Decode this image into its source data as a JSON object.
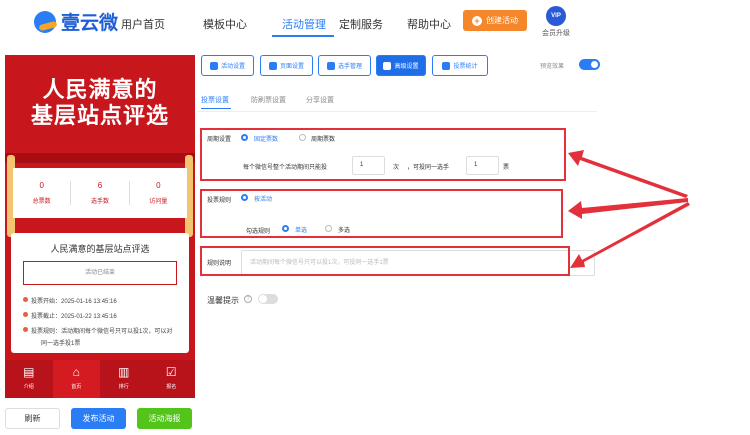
{
  "app": {
    "logo_text": "壹云微"
  },
  "nav": {
    "items": [
      "用户首页",
      "模板中心",
      "活动管理",
      "定制服务",
      "帮助中心"
    ],
    "create_button": "创建活动",
    "vip_badge": "VIP",
    "vip_label": "会员升级"
  },
  "preview": {
    "hero_line1": "人民满意的",
    "hero_line2": "基层站点评选",
    "stats": [
      {
        "value": "0",
        "label": "总票数"
      },
      {
        "value": "6",
        "label": "选手数"
      },
      {
        "value": "0",
        "label": "访问量"
      }
    ],
    "info_title": "人民满意的基层站点评选",
    "status": "活动已结束",
    "rows": [
      "投票开始：2025-01-16 13:45:16",
      "投票截止：2025-01-22 13:45:16",
      "投票规则：活动期间每个微信号只可以投1次，可以对",
      "同一选手投1票"
    ],
    "tabs": [
      "介绍",
      "首页",
      "排行",
      "报名"
    ]
  },
  "bottom_buttons": {
    "refresh": "刷新",
    "publish": "发布活动",
    "poster": "活动海报"
  },
  "toolbar": {
    "buttons": [
      "活动设置",
      "页面设置",
      "选手管理",
      "高级设置",
      "投票统计"
    ],
    "preview_label": "预览效果"
  },
  "subtabs": [
    "投票设置",
    "防刷票设置",
    "分享设置"
  ],
  "settings": {
    "cycle_label": "周期设置",
    "cycle_options": [
      "固定票数",
      "周期票数"
    ],
    "rule_prefix": "每个微信号整个活动期间只能投",
    "votes_total": "1",
    "unit_times": "次",
    "rule_middle": "，可投同一选手",
    "votes_same": "1",
    "unit_votes": "票",
    "voting_rule_label": "投票规则",
    "voting_rule_option": "按活动",
    "check_rule_label": "勾选规则",
    "check_options": [
      "单选",
      "多选"
    ],
    "rule_desc_label": "规则说明",
    "rule_desc_placeholder": "活动期间每个微信号只可以投1次，可投同一选手1票",
    "reminder_label": "温馨提示",
    "help_glyph": "?"
  },
  "colors": {
    "brand": "#2a7df5",
    "accent": "#f5862a",
    "poster_red": "#c8161d",
    "highlight": "#e3303a",
    "green": "#52c41a"
  }
}
